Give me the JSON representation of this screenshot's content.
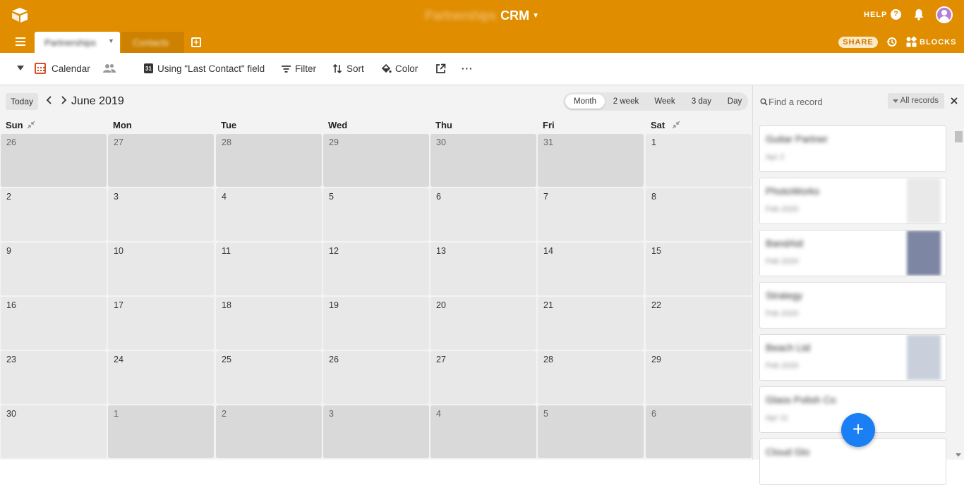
{
  "app": {
    "base_name": "Partnerships",
    "base_suffix": "CRM",
    "help_label": "HELP",
    "help_icon_glyph": "?",
    "share_label": "SHARE",
    "blocks_label": "BLOCKS",
    "accent_color": "#e08d00"
  },
  "tabs": [
    {
      "label": "Partnerships",
      "active": true
    },
    {
      "label": "Contacts",
      "active": false
    }
  ],
  "add_table_glyph": "+",
  "toolbar": {
    "view_name": "Calendar",
    "field_icon_text": "31",
    "date_field": "Using \"Last Contact\" field",
    "filter_label": "Filter",
    "sort_label": "Sort",
    "color_label": "Color",
    "more_glyph": "···"
  },
  "calendar": {
    "today_label": "Today",
    "month_title": "June 2019",
    "ranges": [
      "Month",
      "2 week",
      "Week",
      "3 day",
      "Day"
    ],
    "active_range": "Month",
    "weekdays": [
      "Sun",
      "Mon",
      "Tue",
      "Wed",
      "Thu",
      "Fri",
      "Sat"
    ],
    "weeks": [
      [
        {
          "d": "26",
          "out": true
        },
        {
          "d": "27",
          "out": true
        },
        {
          "d": "28",
          "out": true
        },
        {
          "d": "29",
          "out": true
        },
        {
          "d": "30",
          "out": true
        },
        {
          "d": "31",
          "out": true
        },
        {
          "d": "1",
          "out": false
        }
      ],
      [
        {
          "d": "2",
          "out": false
        },
        {
          "d": "3",
          "out": false
        },
        {
          "d": "4",
          "out": false
        },
        {
          "d": "5",
          "out": false
        },
        {
          "d": "6",
          "out": false
        },
        {
          "d": "7",
          "out": false
        },
        {
          "d": "8",
          "out": false
        }
      ],
      [
        {
          "d": "9",
          "out": false
        },
        {
          "d": "10",
          "out": false
        },
        {
          "d": "11",
          "out": false
        },
        {
          "d": "12",
          "out": false
        },
        {
          "d": "13",
          "out": false
        },
        {
          "d": "14",
          "out": false
        },
        {
          "d": "15",
          "out": false
        }
      ],
      [
        {
          "d": "16",
          "out": false
        },
        {
          "d": "17",
          "out": false
        },
        {
          "d": "18",
          "out": false
        },
        {
          "d": "19",
          "out": false
        },
        {
          "d": "20",
          "out": false
        },
        {
          "d": "21",
          "out": false
        },
        {
          "d": "22",
          "out": false
        }
      ],
      [
        {
          "d": "23",
          "out": false
        },
        {
          "d": "24",
          "out": false
        },
        {
          "d": "25",
          "out": false
        },
        {
          "d": "26",
          "out": false
        },
        {
          "d": "27",
          "out": false
        },
        {
          "d": "28",
          "out": false
        },
        {
          "d": "29",
          "out": false
        }
      ],
      [
        {
          "d": "30",
          "out": false
        },
        {
          "d": "1",
          "out": true
        },
        {
          "d": "2",
          "out": true
        },
        {
          "d": "3",
          "out": true
        },
        {
          "d": "4",
          "out": true
        },
        {
          "d": "5",
          "out": true
        },
        {
          "d": "6",
          "out": true
        }
      ]
    ]
  },
  "sidebar": {
    "search_placeholder": "Find a record",
    "filter_label": "All records",
    "records": [
      {
        "name": "Guitar Partner",
        "date": "Apr 2",
        "thumb": ""
      },
      {
        "name": "PhotoWorks",
        "date": "Feb 2020",
        "thumb": "#e9e9e9"
      },
      {
        "name": "BandAid",
        "date": "Feb 2020",
        "thumb": "#7d86a3"
      },
      {
        "name": "Strategy",
        "date": "Feb 2020",
        "thumb": ""
      },
      {
        "name": "Beach Ltd",
        "date": "Feb 2020",
        "thumb": "#c9d0dc"
      },
      {
        "name": "Glass Polish Co",
        "date": "Apr 11",
        "thumb": ""
      },
      {
        "name": "Cloud Glo",
        "date": "",
        "thumb": ""
      }
    ]
  },
  "fab_glyph": "+"
}
